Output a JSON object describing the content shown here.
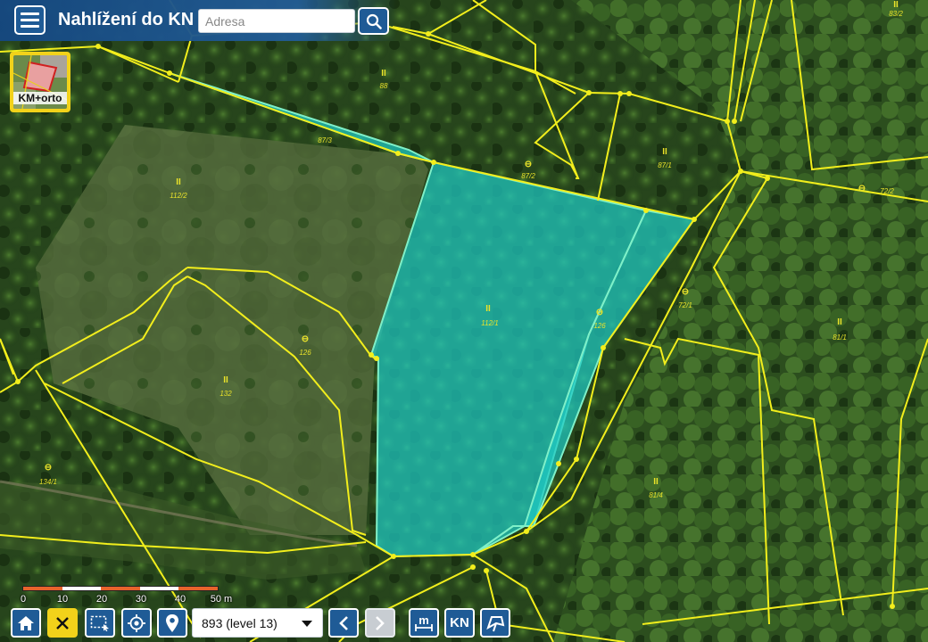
{
  "header": {
    "title": "Nahlížení do KN",
    "search_placeholder": "Adresa"
  },
  "layer_switcher": {
    "label": "KM+orto"
  },
  "map": {
    "parcels": [
      {
        "id": "p-83-2",
        "label": "83/2",
        "symbol": "II"
      },
      {
        "id": "p-88",
        "label": "88",
        "symbol": "II"
      },
      {
        "id": "p-87-3",
        "label": "87/3",
        "symbol": ""
      },
      {
        "id": "p-87-2",
        "label": "87/2",
        "symbol": "⊖"
      },
      {
        "id": "p-87-1",
        "label": "87/1",
        "symbol": "II"
      },
      {
        "id": "p-72-2",
        "label": "72/2",
        "symbol": "⊖"
      },
      {
        "id": "p-112-2",
        "label": "112/2",
        "symbol": "II"
      },
      {
        "id": "p-112-1",
        "label": "112/1",
        "symbol": "II"
      },
      {
        "id": "p-126a",
        "label": "126",
        "symbol": "⊖"
      },
      {
        "id": "p-72-1",
        "label": "72/1",
        "symbol": "⊖"
      },
      {
        "id": "p-81-1",
        "label": "81/1",
        "symbol": "II"
      },
      {
        "id": "p-126b",
        "label": "126",
        "symbol": "⊖"
      },
      {
        "id": "p-132",
        "label": "132",
        "symbol": "II"
      },
      {
        "id": "p-134-1",
        "label": "134/1",
        "symbol": "⊖"
      },
      {
        "id": "p-81-4",
        "label": "81/4",
        "symbol": "II"
      }
    ],
    "colors": {
      "boundary": "#f2ee1c",
      "selection_fill": "#1fc9c4",
      "selection_stroke": "#7ff0c8"
    }
  },
  "scale": {
    "labels": [
      "0",
      "10",
      "20",
      "30",
      "40",
      "50 m"
    ],
    "colors": [
      "#e8632b",
      "#ffffff",
      "#e8632b",
      "#ffffff",
      "#e8632b"
    ]
  },
  "toolbar": {
    "level_select": "893 (level 13)",
    "kn_label": "KN"
  }
}
